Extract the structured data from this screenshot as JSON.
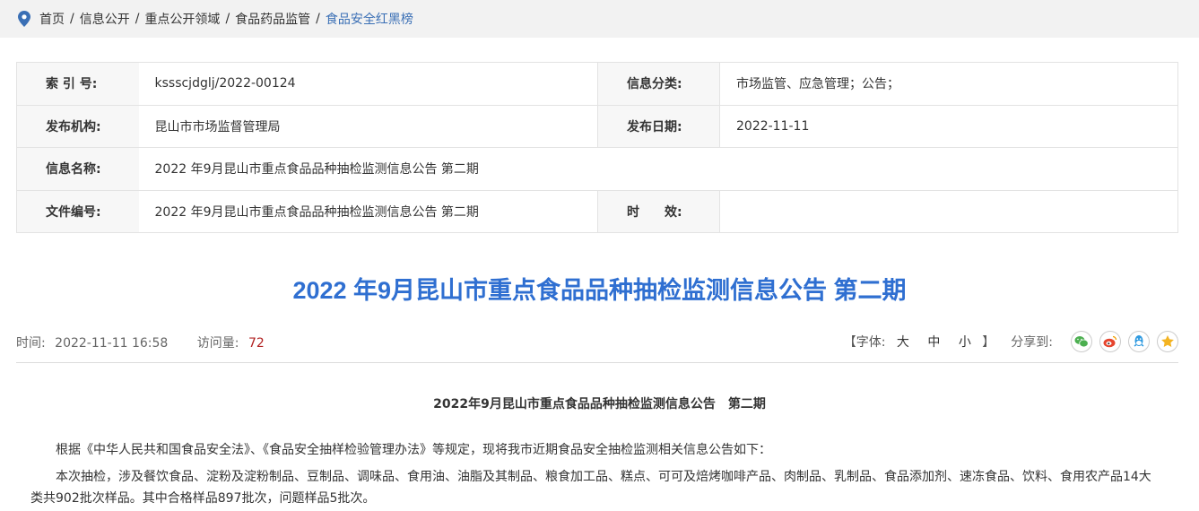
{
  "breadcrumb": {
    "items": [
      "首页",
      "信息公开",
      "重点公开领域",
      "食品药品监管",
      "食品安全红黑榜"
    ],
    "separator": "/"
  },
  "meta": {
    "index_label": "索 引 号:",
    "index_value": "ksssсjdglj/2022-00124",
    "category_label": "信息分类:",
    "category_value": "市场监管、应急管理；公告；",
    "publisher_label": "发布机构:",
    "publisher_value": "昆山市市场监督管理局",
    "date_label": "发布日期:",
    "date_value": "2022-11-11",
    "name_label": "信息名称:",
    "name_value": "2022 年9月昆山市重点食品品种抽检监测信息公告 第二期",
    "doc_label": "文件编号:",
    "doc_value": "2022 年9月昆山市重点食品品种抽检监测信息公告 第二期",
    "validity_label": "时　　效:",
    "validity_value": ""
  },
  "article": {
    "title": "2022 年9月昆山市重点食品品种抽检监测信息公告 第二期",
    "time_label": "时间:",
    "time_value": "2022-11-11 16:58",
    "visits_label": "访问量:",
    "visits_value": "72",
    "font_open": "【字体:",
    "font_large": "大",
    "font_medium": "中",
    "font_small": "小",
    "font_close": "】",
    "share_label": "分享到:",
    "subtitle": "2022年9月昆山市重点食品品种抽检监测信息公告　第二期",
    "para1": "根据《中华人民共和国食品安全法》、《食品安全抽样检验管理办法》等规定，现将我市近期食品安全抽检监测相关信息公告如下：",
    "para2_line1": "本次抽检，涉及餐饮食品、淀粉及淀粉制品、豆制品、调味品、食用油、油脂及其制品、粮食加工品、糕点、可可及焙烤咖啡产品、肉制品、乳制品、食品添加剂、速冻食品、饮料、食用农产品14大",
    "para2_line2": "类共902批次样品。其中合格样品897批次，问题样品5批次。"
  },
  "colors": {
    "accent": "#2f6fd1",
    "breadcrumb_current": "#3a6fb5",
    "wechat": "#4caf50",
    "weibo": "#e6452e",
    "qq": "#2f9ae0",
    "qzone": "#f3b321"
  },
  "icons": {
    "location": "location-pin-icon",
    "wechat": "wechat-icon",
    "weibo": "weibo-icon",
    "qq": "qq-icon",
    "qzone": "qzone-star-icon"
  }
}
